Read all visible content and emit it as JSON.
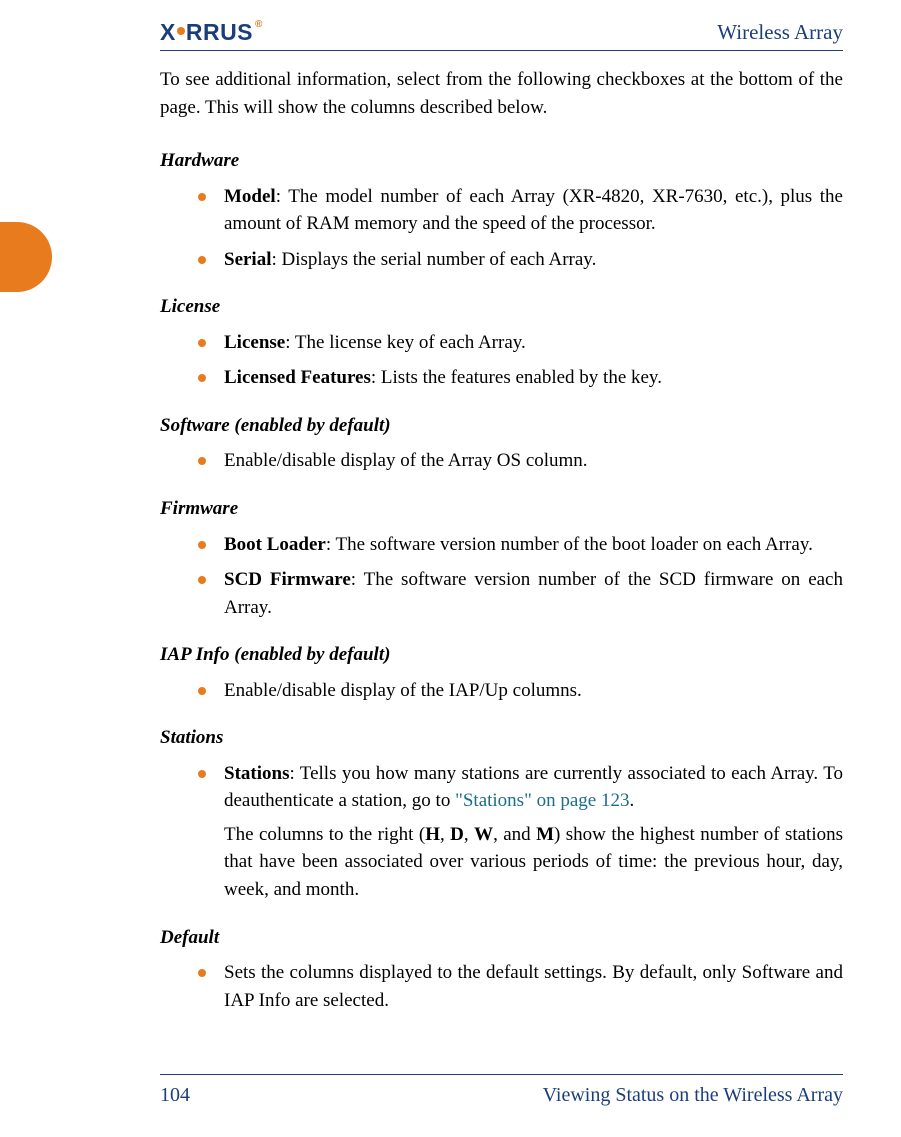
{
  "header": {
    "logo": {
      "pre": "X",
      "mid": "RRUS",
      "reg": "®"
    },
    "doc_title": "Wireless Array"
  },
  "intro": "To see additional information, select from the following checkboxes at the bottom of the page. This will show the columns described below.",
  "sections": {
    "hardware": {
      "title": "Hardware",
      "items": {
        "model": {
          "term": "Model",
          "desc": ": The model number of each Array (XR-4820, XR-7630, etc.), plus the amount of RAM memory and the speed of the processor."
        },
        "serial": {
          "term": "Serial",
          "desc": ": Displays the serial number of each Array."
        }
      }
    },
    "license": {
      "title": "License",
      "items": {
        "license": {
          "term": "License",
          "desc": ": The license key of each Array."
        },
        "features": {
          "term": "Licensed Features",
          "desc": ": Lists the features enabled by the key."
        }
      }
    },
    "software": {
      "title": "Software (enabled by default)",
      "items": {
        "enable": {
          "desc": "Enable/disable display of the Array OS column."
        }
      }
    },
    "firmware": {
      "title": "Firmware",
      "items": {
        "boot": {
          "term": "Boot Loader",
          "desc": ": The software version number of the boot loader on each Array."
        },
        "scd": {
          "term": "SCD Firmware",
          "desc": ": The software version number of the SCD firmware on each Array."
        }
      }
    },
    "iap": {
      "title": "IAP Info (enabled by default)",
      "items": {
        "enable": {
          "desc": "Enable/disable display of the IAP/Up columns."
        }
      }
    },
    "stations": {
      "title": "Stations",
      "items": {
        "stations": {
          "term": "Stations",
          "desc1": ": Tells you how many stations are currently associated to each Array. To deauthenticate a station, go to ",
          "link": "\"Stations\" on page 123",
          "desc2": ".",
          "para_pre": "The columns to the right (",
          "h": "H",
          "c1": ", ",
          "d": "D",
          "c2": ", ",
          "w": "W",
          "c3": ", and ",
          "m": "M",
          "para_post": ") show the highest number of stations that have been associated over various periods of time: the previous hour, day, week, and month."
        }
      }
    },
    "default": {
      "title": "Default",
      "items": {
        "sets": {
          "desc": "Sets the columns displayed to the default settings. By default, only Software and IAP Info are selected."
        }
      }
    }
  },
  "footer": {
    "page": "104",
    "section": "Viewing Status on the Wireless Array"
  }
}
